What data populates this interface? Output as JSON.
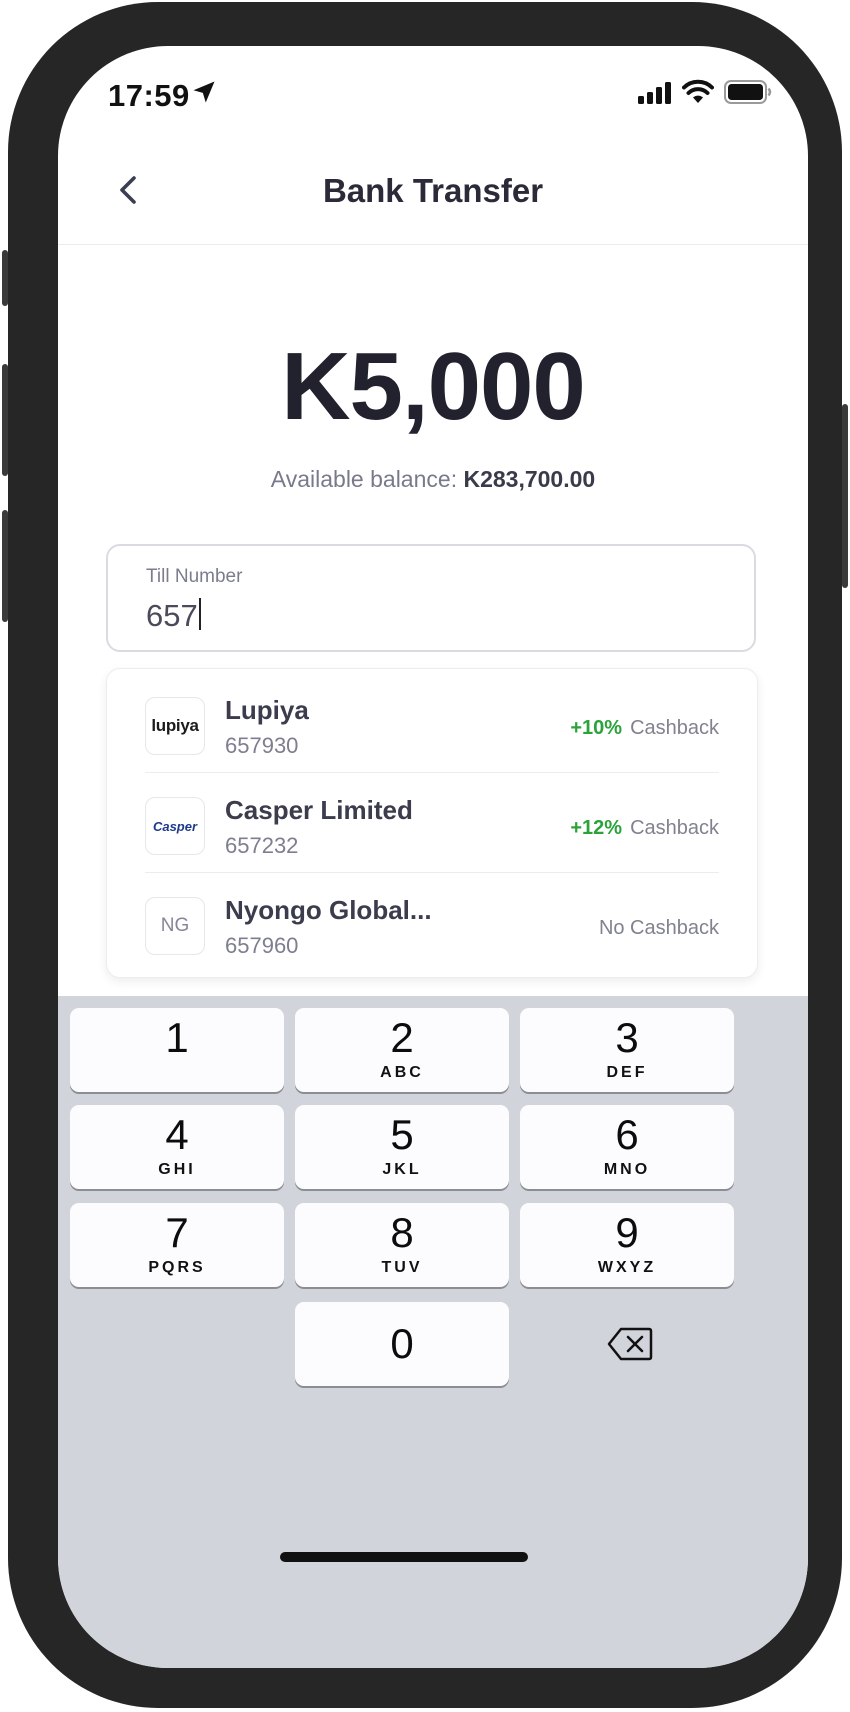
{
  "status_bar": {
    "time": "17:59"
  },
  "header": {
    "title": "Bank Transfer"
  },
  "amount": {
    "value": "K5,000",
    "balance_label": "Available balance",
    "balance_value": "K283,700.00"
  },
  "till": {
    "label": "Till Number",
    "value": "657"
  },
  "suggestions": [
    {
      "logo": "lupiya",
      "logo_text": "lupiya",
      "name": "Lupiya",
      "number": "657930",
      "cashback_pct": "+10%",
      "cashback_label": "Cashback"
    },
    {
      "logo": "casper",
      "logo_text": "Casper",
      "name": "Casper Limited",
      "number": "657232",
      "cashback_pct": "+12%",
      "cashback_label": "Cashback"
    },
    {
      "logo": "initials",
      "logo_text": "NG",
      "name": "Nyongo Global...",
      "number": "657960",
      "cashback_pct": "",
      "cashback_label": "No Cashback"
    }
  ],
  "keypad": {
    "keys": [
      {
        "num": "1",
        "letters": ""
      },
      {
        "num": "2",
        "letters": "ABC"
      },
      {
        "num": "3",
        "letters": "DEF"
      },
      {
        "num": "4",
        "letters": "GHI"
      },
      {
        "num": "5",
        "letters": "JKL"
      },
      {
        "num": "6",
        "letters": "MNO"
      },
      {
        "num": "7",
        "letters": "PQRS"
      },
      {
        "num": "8",
        "letters": "TUV"
      },
      {
        "num": "9",
        "letters": "WXYZ"
      },
      {
        "num": "0",
        "letters": ""
      }
    ]
  },
  "colors": {
    "accent_green": "#2aa33a",
    "keyboard_bg": "#d1d4db"
  },
  "icons": [
    "back-arrow-icon",
    "location-arrow-icon",
    "signal-icon",
    "wifi-icon",
    "battery-icon",
    "backspace-icon"
  ]
}
